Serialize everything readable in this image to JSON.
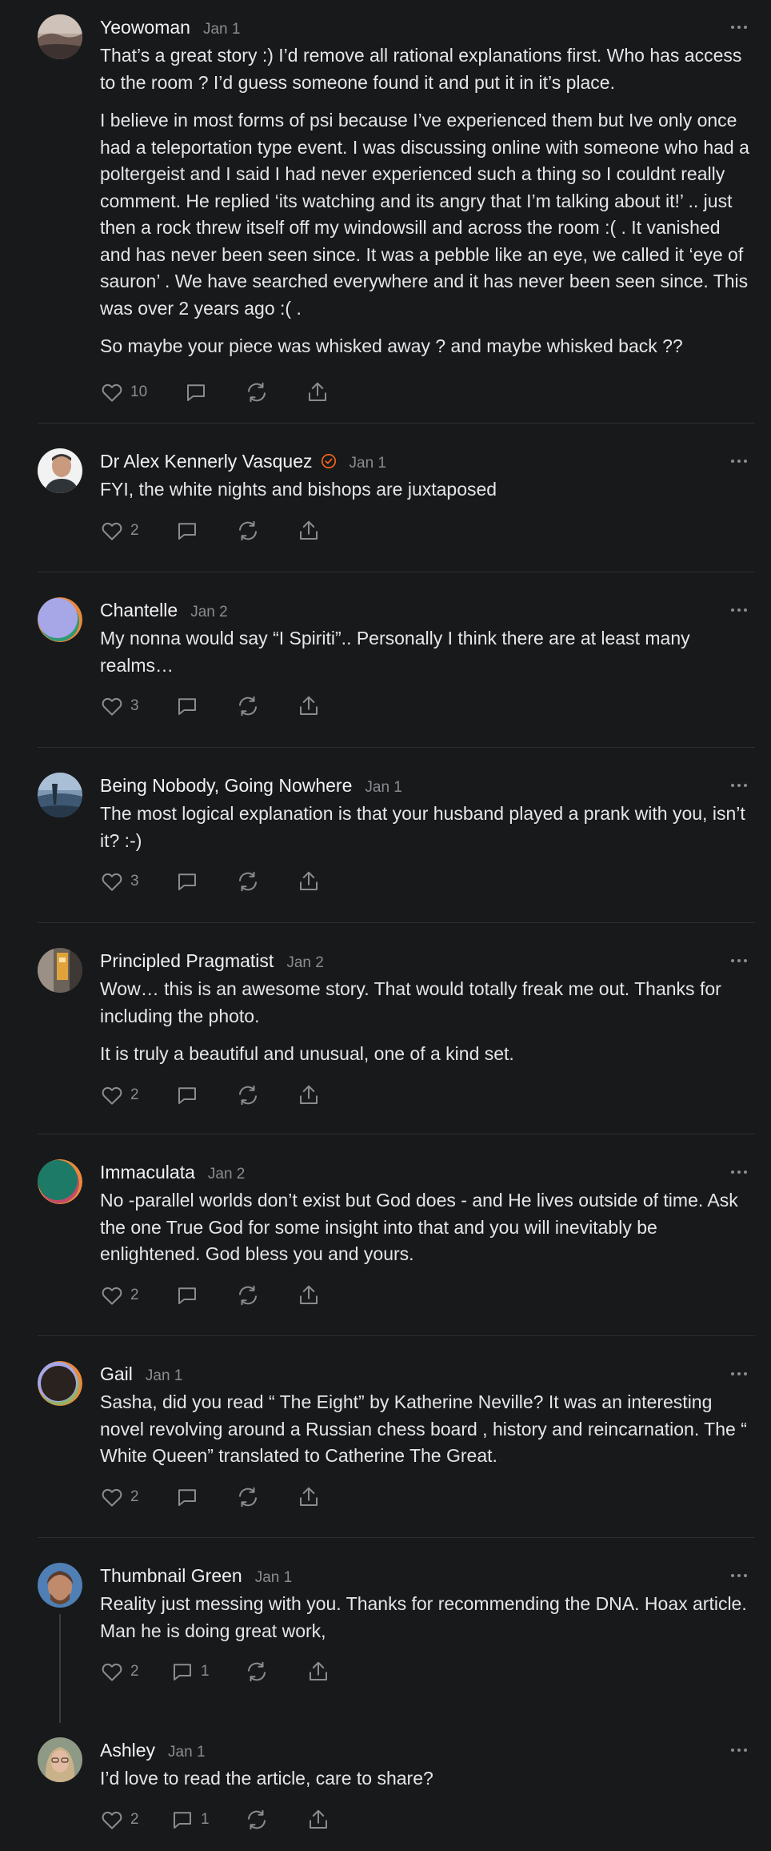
{
  "comments": [
    {
      "author": "Yeowoman",
      "date": "Jan 1",
      "verified": false,
      "paragraphs": [
        "That’s a great story :) I’d remove all rational explanations first. Who has access to the room ? I’d guess someone found it and put it in it’s place.",
        "I believe in most forms of psi because I’ve experienced them but Ive only once had a teleportation type event. I was discussing online with someone who had a poltergeist and I said I had never experienced such a thing so I couldnt really comment. He replied ‘its watching and its angry that I’m talking about it!’ .. just then a rock threw itself off my windowsill and across the room :( . It vanished and has never been seen since. It was a pebble like an eye, we called it ‘eye of sauron’ . We have searched everywhere and it has never been seen since. This was over 2 years ago :( .",
        "So maybe your piece was whisked away ? and maybe whisked back ??"
      ],
      "likes": "10",
      "replies": ""
    },
    {
      "author": "Dr Alex Kennerly Vasquez",
      "date": "Jan 1",
      "verified": true,
      "paragraphs": [
        "FYI, the white nights and bishops are juxtaposed"
      ],
      "likes": "2",
      "replies": ""
    },
    {
      "author": "Chantelle",
      "date": "Jan 2",
      "verified": false,
      "paragraphs": [
        "My nonna would say “I Spiriti”.. Personally I think there are at least many realms…"
      ],
      "likes": "3",
      "replies": ""
    },
    {
      "author": "Being Nobody, Going Nowhere",
      "date": "Jan 1",
      "verified": false,
      "paragraphs": [
        "The most logical explanation is that your husband played a prank with you, isn’t it? :-)"
      ],
      "likes": "3",
      "replies": ""
    },
    {
      "author": "Principled Pragmatist",
      "date": "Jan 2",
      "verified": false,
      "paragraphs": [
        "Wow… this is an awesome story. That would totally freak me out. Thanks for including the photo.",
        "It is truly a beautiful and unusual, one of a kind set."
      ],
      "likes": "2",
      "replies": ""
    },
    {
      "author": "Immaculata",
      "date": "Jan 2",
      "verified": false,
      "paragraphs": [
        "No -parallel worlds don’t exist but God does - and He lives outside of time. Ask the one True God for some insight into that and you will inevitably be enlightened. God bless you and yours."
      ],
      "likes": "2",
      "replies": ""
    },
    {
      "author": "Gail",
      "date": "Jan 1",
      "verified": false,
      "paragraphs": [
        "Sasha, did you read “ The Eight” by Katherine Neville? It was an interesting novel revolving around a Russian chess board , history and reincarnation. The “ White Queen” translated to Catherine The Great."
      ],
      "likes": "2",
      "replies": ""
    },
    {
      "author": "Thumbnail Green",
      "date": "Jan 1",
      "verified": false,
      "paragraphs": [
        "Reality just messing with you. Thanks for recommending the DNA. Hoax article. Man he is doing great work,"
      ],
      "likes": "2",
      "replies": "1"
    },
    {
      "author": "Ashley",
      "date": "Jan 1",
      "verified": false,
      "paragraphs": [
        "I’d love to read the article, care to share?"
      ],
      "likes": "2",
      "replies": "1"
    }
  ],
  "colors": {
    "background": "#18191b",
    "text": "#e6e6e8",
    "muted": "#8b8c90",
    "verified_badge": "#ff6719",
    "divider": "#2d2e31"
  },
  "icons": {
    "like": "heart-icon",
    "reply": "comment-icon",
    "restack": "restack-icon",
    "share": "share-icon",
    "more": "more-icon",
    "verified": "verified-badge-icon"
  }
}
